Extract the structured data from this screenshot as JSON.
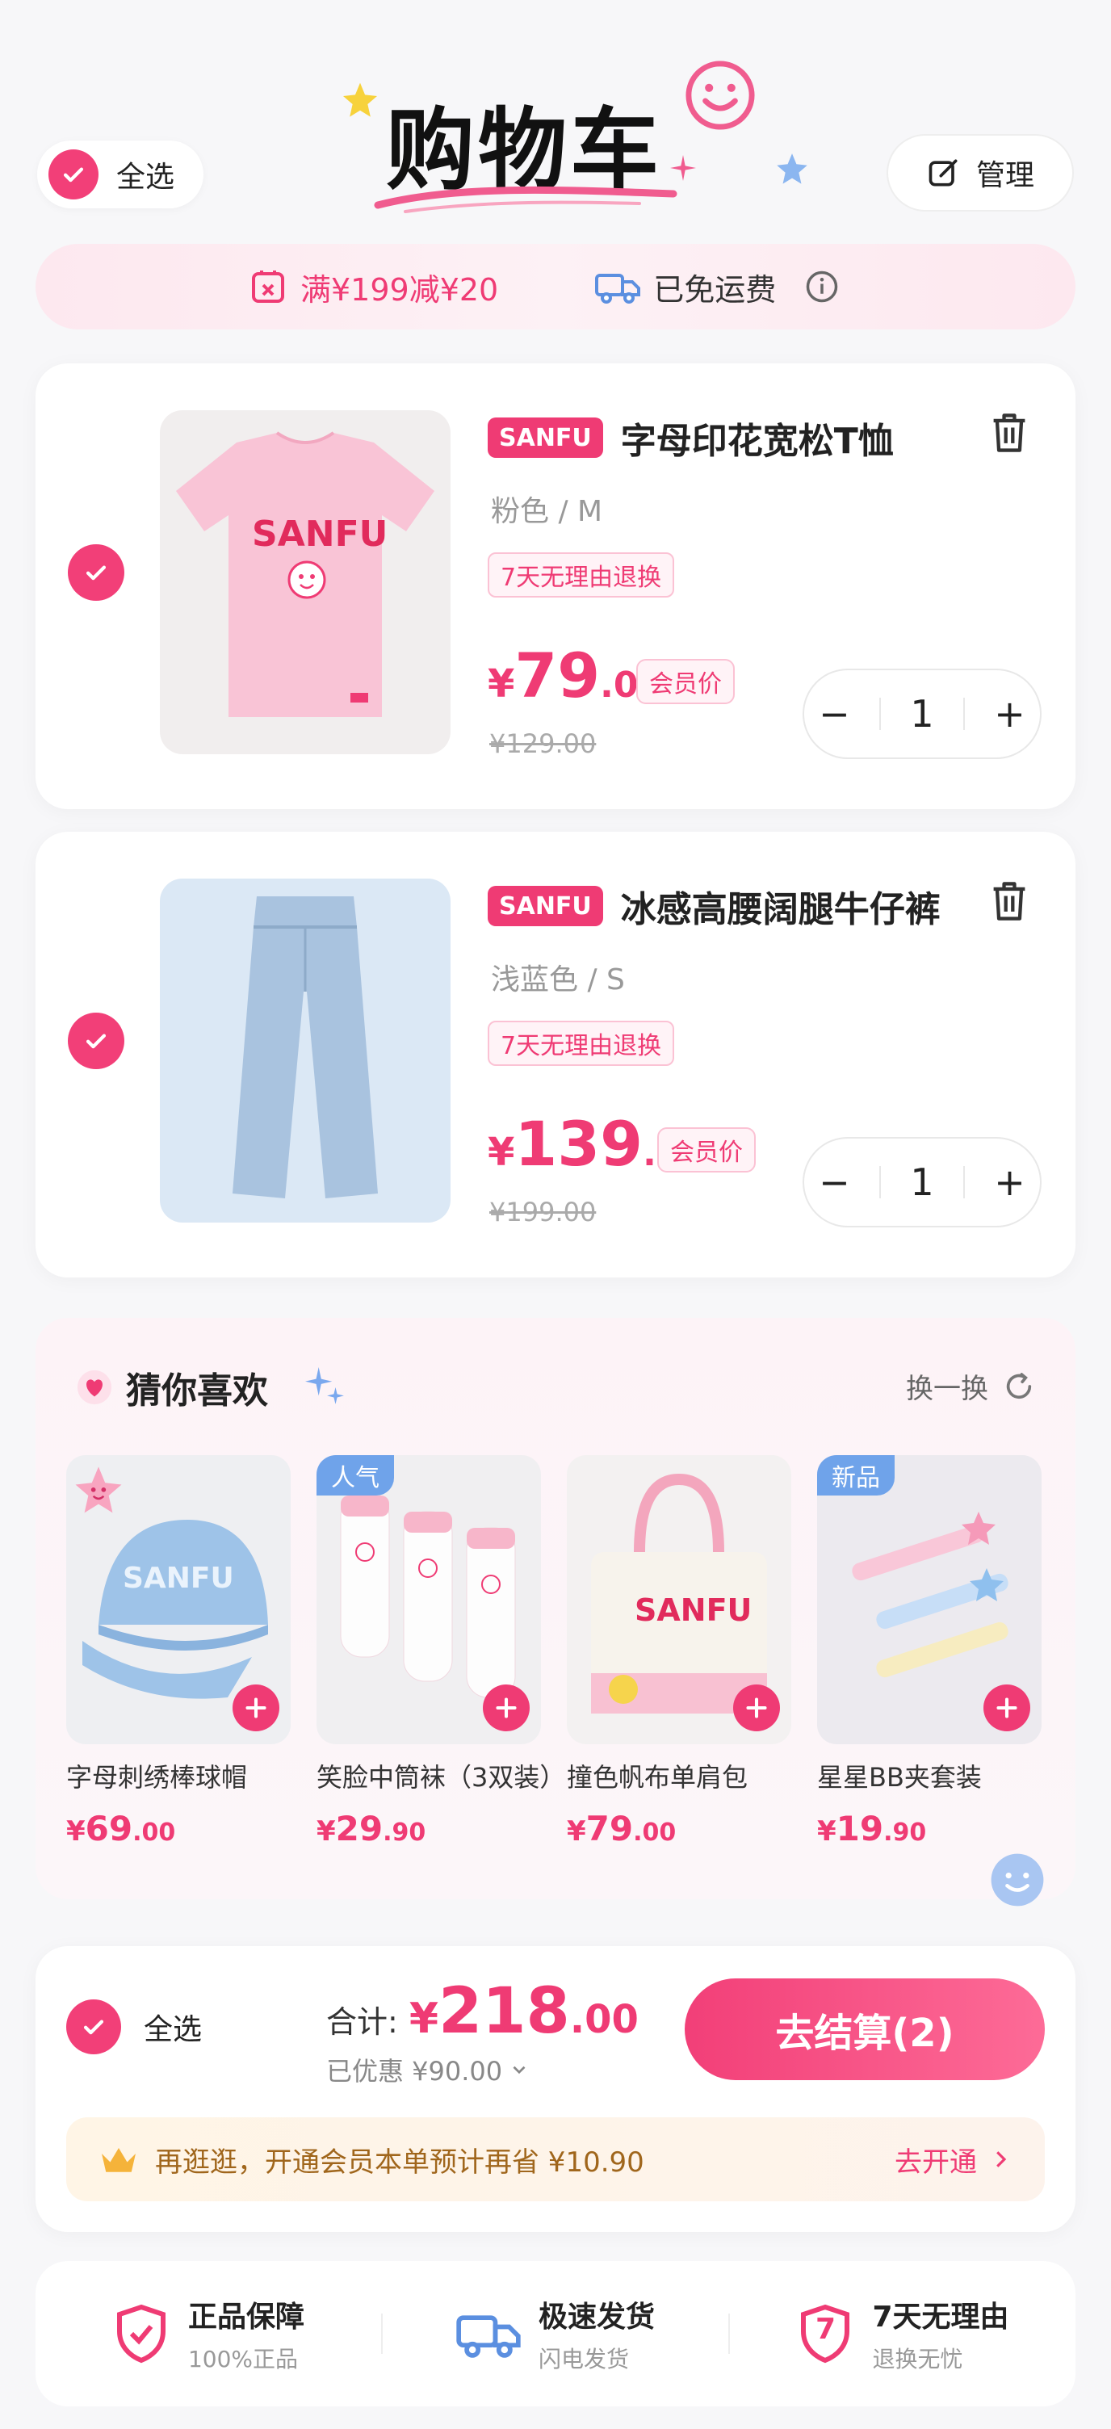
{
  "header": {
    "select_all": "全选",
    "title": "购物车",
    "manage": "管理"
  },
  "promo": {
    "discount": "满¥199减¥20",
    "shipping": "已免运费"
  },
  "cart": [
    {
      "brand": "SANFU",
      "name": "字母印花宽松T恤",
      "variant": "粉色 / M",
      "return_tag": "7天无理由退换",
      "price_symbol": "¥",
      "price_int": "79",
      "price_dec": ".00",
      "member_tag": "会员价",
      "old_price": "¥129.00",
      "quantity": "1",
      "minus": "−",
      "plus": "+",
      "print_text": "SANFU"
    },
    {
      "brand": "SANFU",
      "name": "冰感高腰阔腿牛仔裤",
      "variant": "浅蓝色 / S",
      "return_tag": "7天无理由退换",
      "price_symbol": "¥",
      "price_int": "139",
      "price_dec": ".00",
      "member_tag": "会员价",
      "old_price": "¥199.00",
      "quantity": "1",
      "minus": "−",
      "plus": "+"
    }
  ],
  "recommend": {
    "title": "猜你喜欢",
    "refresh": "换一换",
    "items": [
      {
        "name": "字母刺绣棒球帽",
        "price_symbol": "¥",
        "price_int": "69",
        "price_dec": ".00",
        "badge": "",
        "print_text": "SANFU"
      },
      {
        "name": "笑脸中筒袜（3双装）",
        "price_symbol": "¥",
        "price_int": "29",
        "price_dec": ".90",
        "badge": "人气"
      },
      {
        "name": "撞色帆布单肩包",
        "price_symbol": "¥",
        "price_int": "79",
        "price_dec": ".00",
        "badge": "",
        "print_text": "SANFU"
      },
      {
        "name": "星星BB夹套装",
        "price_symbol": "¥",
        "price_int": "19",
        "price_dec": ".90",
        "badge": "新品"
      }
    ]
  },
  "summary": {
    "select_all": "全选",
    "total_label": "合计:",
    "total_symbol": "¥",
    "total_int": "218",
    "total_dec": ".00",
    "saved": "已优惠 ¥90.00",
    "checkout": "去结算(2)",
    "vip_text": "再逛逛，开通会员本单预计再省 ¥10.90",
    "vip_action": "去开通"
  },
  "guarantees": [
    {
      "title": "正品保障",
      "sub": "100%正品",
      "icon_text": ""
    },
    {
      "title": "极速发货",
      "sub": "闪电发货",
      "icon_text": ""
    },
    {
      "title": "7天无理由",
      "sub": "退换无忧",
      "icon_text": "7"
    }
  ],
  "colors": {
    "accent": "#ef3b74",
    "blue": "#6fa3ea"
  }
}
